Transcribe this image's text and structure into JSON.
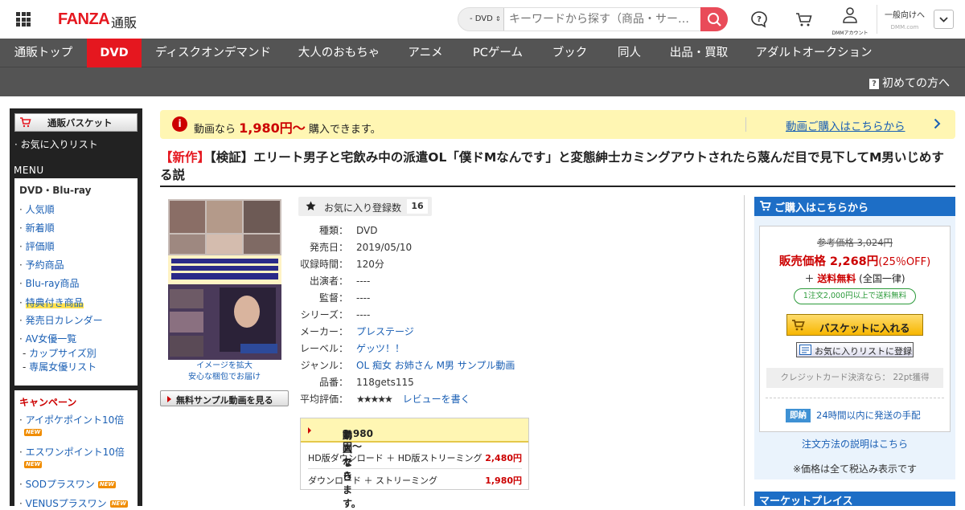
{
  "header": {
    "logo": "FANZA",
    "logo_sub": "通販",
    "search_scope": "- DVD",
    "search_placeholder": "キーワードから探す（商品・サー…",
    "account_label": "DMMアカウント",
    "general_label": "一般向けへ",
    "general_sub": "DMM.com"
  },
  "nav": {
    "items": [
      {
        "label": "通販トップ",
        "active": false
      },
      {
        "label": "DVD",
        "active": true
      },
      {
        "label": "ディスクオンデマンド",
        "active": false
      },
      {
        "label": "大人のおもちゃ",
        "active": false
      },
      {
        "label": "アニメ",
        "active": false
      },
      {
        "label": "PCゲーム",
        "active": false
      },
      {
        "label": "ブック",
        "active": false
      },
      {
        "label": "同人",
        "active": false
      },
      {
        "label": "出品・買取",
        "active": false
      },
      {
        "label": "アダルトオークション",
        "active": false
      }
    ],
    "first_time": "初めての方へ"
  },
  "sidebar": {
    "basket": "通販バスケット",
    "favorites": "· お気に入りリスト",
    "menu_title": "MENU",
    "menu_heading": "DVD・Blu-ray",
    "menu_items": [
      {
        "label": "人気順",
        "highlight": false,
        "sub": false
      },
      {
        "label": "新着順",
        "highlight": false,
        "sub": false
      },
      {
        "label": "評価順",
        "highlight": false,
        "sub": false
      },
      {
        "label": "予約商品",
        "highlight": false,
        "sub": false
      },
      {
        "label": "Blu-ray商品",
        "highlight": false,
        "sub": false
      },
      {
        "label": "特典付き商品",
        "highlight": true,
        "sub": false
      },
      {
        "label": "発売日カレンダー",
        "highlight": false,
        "sub": false
      },
      {
        "label": "AV女優一覧",
        "highlight": false,
        "sub": false
      },
      {
        "label": "カップサイズ別",
        "highlight": false,
        "sub": true
      },
      {
        "label": "専属女優リスト",
        "highlight": false,
        "sub": true
      }
    ],
    "campaign_title": "キャンペーン",
    "campaigns": [
      {
        "label": "アイポケポイント10倍",
        "new": true
      },
      {
        "label": "エスワンポイント10倍",
        "new": true
      },
      {
        "label": "SODプラスワン",
        "new": true
      },
      {
        "label": "VENUSプラスワン",
        "new": true
      }
    ],
    "new_badge": "NEW"
  },
  "banner": {
    "pre": "動画なら",
    "price": "1,980円～",
    "post": "購入できます。",
    "link": "動画ご購入はこちらから"
  },
  "product": {
    "tag": "【新作】",
    "title": "【検証】エリート男子と宅飲み中の派遣OL「僕ドMなんです」と変態紳士カミングアウトされたら蔑んだ目で見下してM男いじめする説",
    "image_caption_1": "イメージを拡大",
    "image_caption_2": "安心な梱包でお届け",
    "sample_button": "無料サンプル動画を見る",
    "favorite_label": "お気に入り登録数",
    "favorite_count": "16",
    "details": [
      {
        "key": "種類：",
        "value": "DVD",
        "link": false
      },
      {
        "key": "発売日：",
        "value": "2019/05/10",
        "link": false
      },
      {
        "key": "収録時間：",
        "value": "120分",
        "link": false
      },
      {
        "key": "出演者：",
        "value": "----",
        "link": false
      },
      {
        "key": "監督：",
        "value": "----",
        "link": false
      },
      {
        "key": "シリーズ：",
        "value": "----",
        "link": false
      },
      {
        "key": "メーカー：",
        "value": "プレステージ",
        "link": true
      },
      {
        "key": "レーベル：",
        "value": "ゲッツ！！",
        "link": true
      },
      {
        "key": "ジャンル：",
        "value": "OL 痴女 お姉さん M男 サンプル動画",
        "link": true
      },
      {
        "key": "品番：",
        "value": "118gets115",
        "link": false
      }
    ],
    "rating_key": "平均評価：",
    "rating_stars": "★★★★★",
    "review_link": "レビューを書く",
    "video": {
      "pre": "動画なら",
      "price": "1,980円～",
      "post": "購入できます。",
      "options": [
        {
          "label": "HD版ダウンロード ＋ HD版ストリーミング",
          "price": "2,480円"
        },
        {
          "label": "ダウンロード ＋ ストリーミング",
          "price": "1,980円"
        }
      ]
    }
  },
  "purchase": {
    "header": "ご購入はこちらから",
    "ref_price": "参考価格 3,024円",
    "sale_label": "販売価格 2,268円",
    "discount": "(25％OFF)",
    "ship_pre": "＋",
    "ship_free": "送料無料",
    "ship_post": "(全国一律)",
    "free_badge": "1注文2,000円以上で送料無料",
    "basket_button": "バスケットに入れる",
    "favorite_button": "お気に入りリストに登録",
    "credit": "クレジットカード決済なら： 22pt獲得",
    "sokuno_badge": "即納",
    "sokuno": "24時間以内に発送の手配",
    "howto": "注文方法の説明はこちら",
    "tax_note": "※価格は全て税込み表示です",
    "marketplace": "マーケットプレイス"
  },
  "colors": {
    "brand_red": "#e5171f",
    "nav_gray": "#545454",
    "link_blue": "#1a5fb4",
    "panel_blue": "#1d6ec6",
    "banner_yellow": "#fff6b3"
  }
}
